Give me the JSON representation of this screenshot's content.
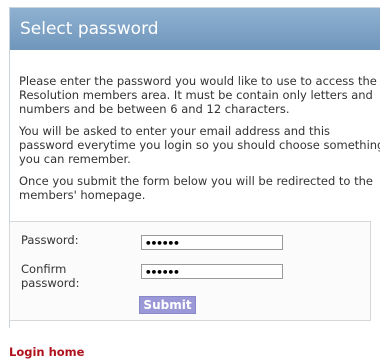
{
  "header": {
    "title": "Select password"
  },
  "intro": [
    "Please enter the password you would like to use to access the Resolution members area. It must be contain only letters and numbers and be between 6 and 12 characters.",
    "You will be asked to enter your email address and this password everytime you login so you should choose something you can remember.",
    "Once you submit the form below you will be redirected to the members' homepage."
  ],
  "form": {
    "password_label": "Password:",
    "password_value": "••••••",
    "confirm_label": "Confirm password:",
    "confirm_value": "••••••",
    "submit_label": "Submit"
  },
  "footer": {
    "login_link": "Login home"
  }
}
